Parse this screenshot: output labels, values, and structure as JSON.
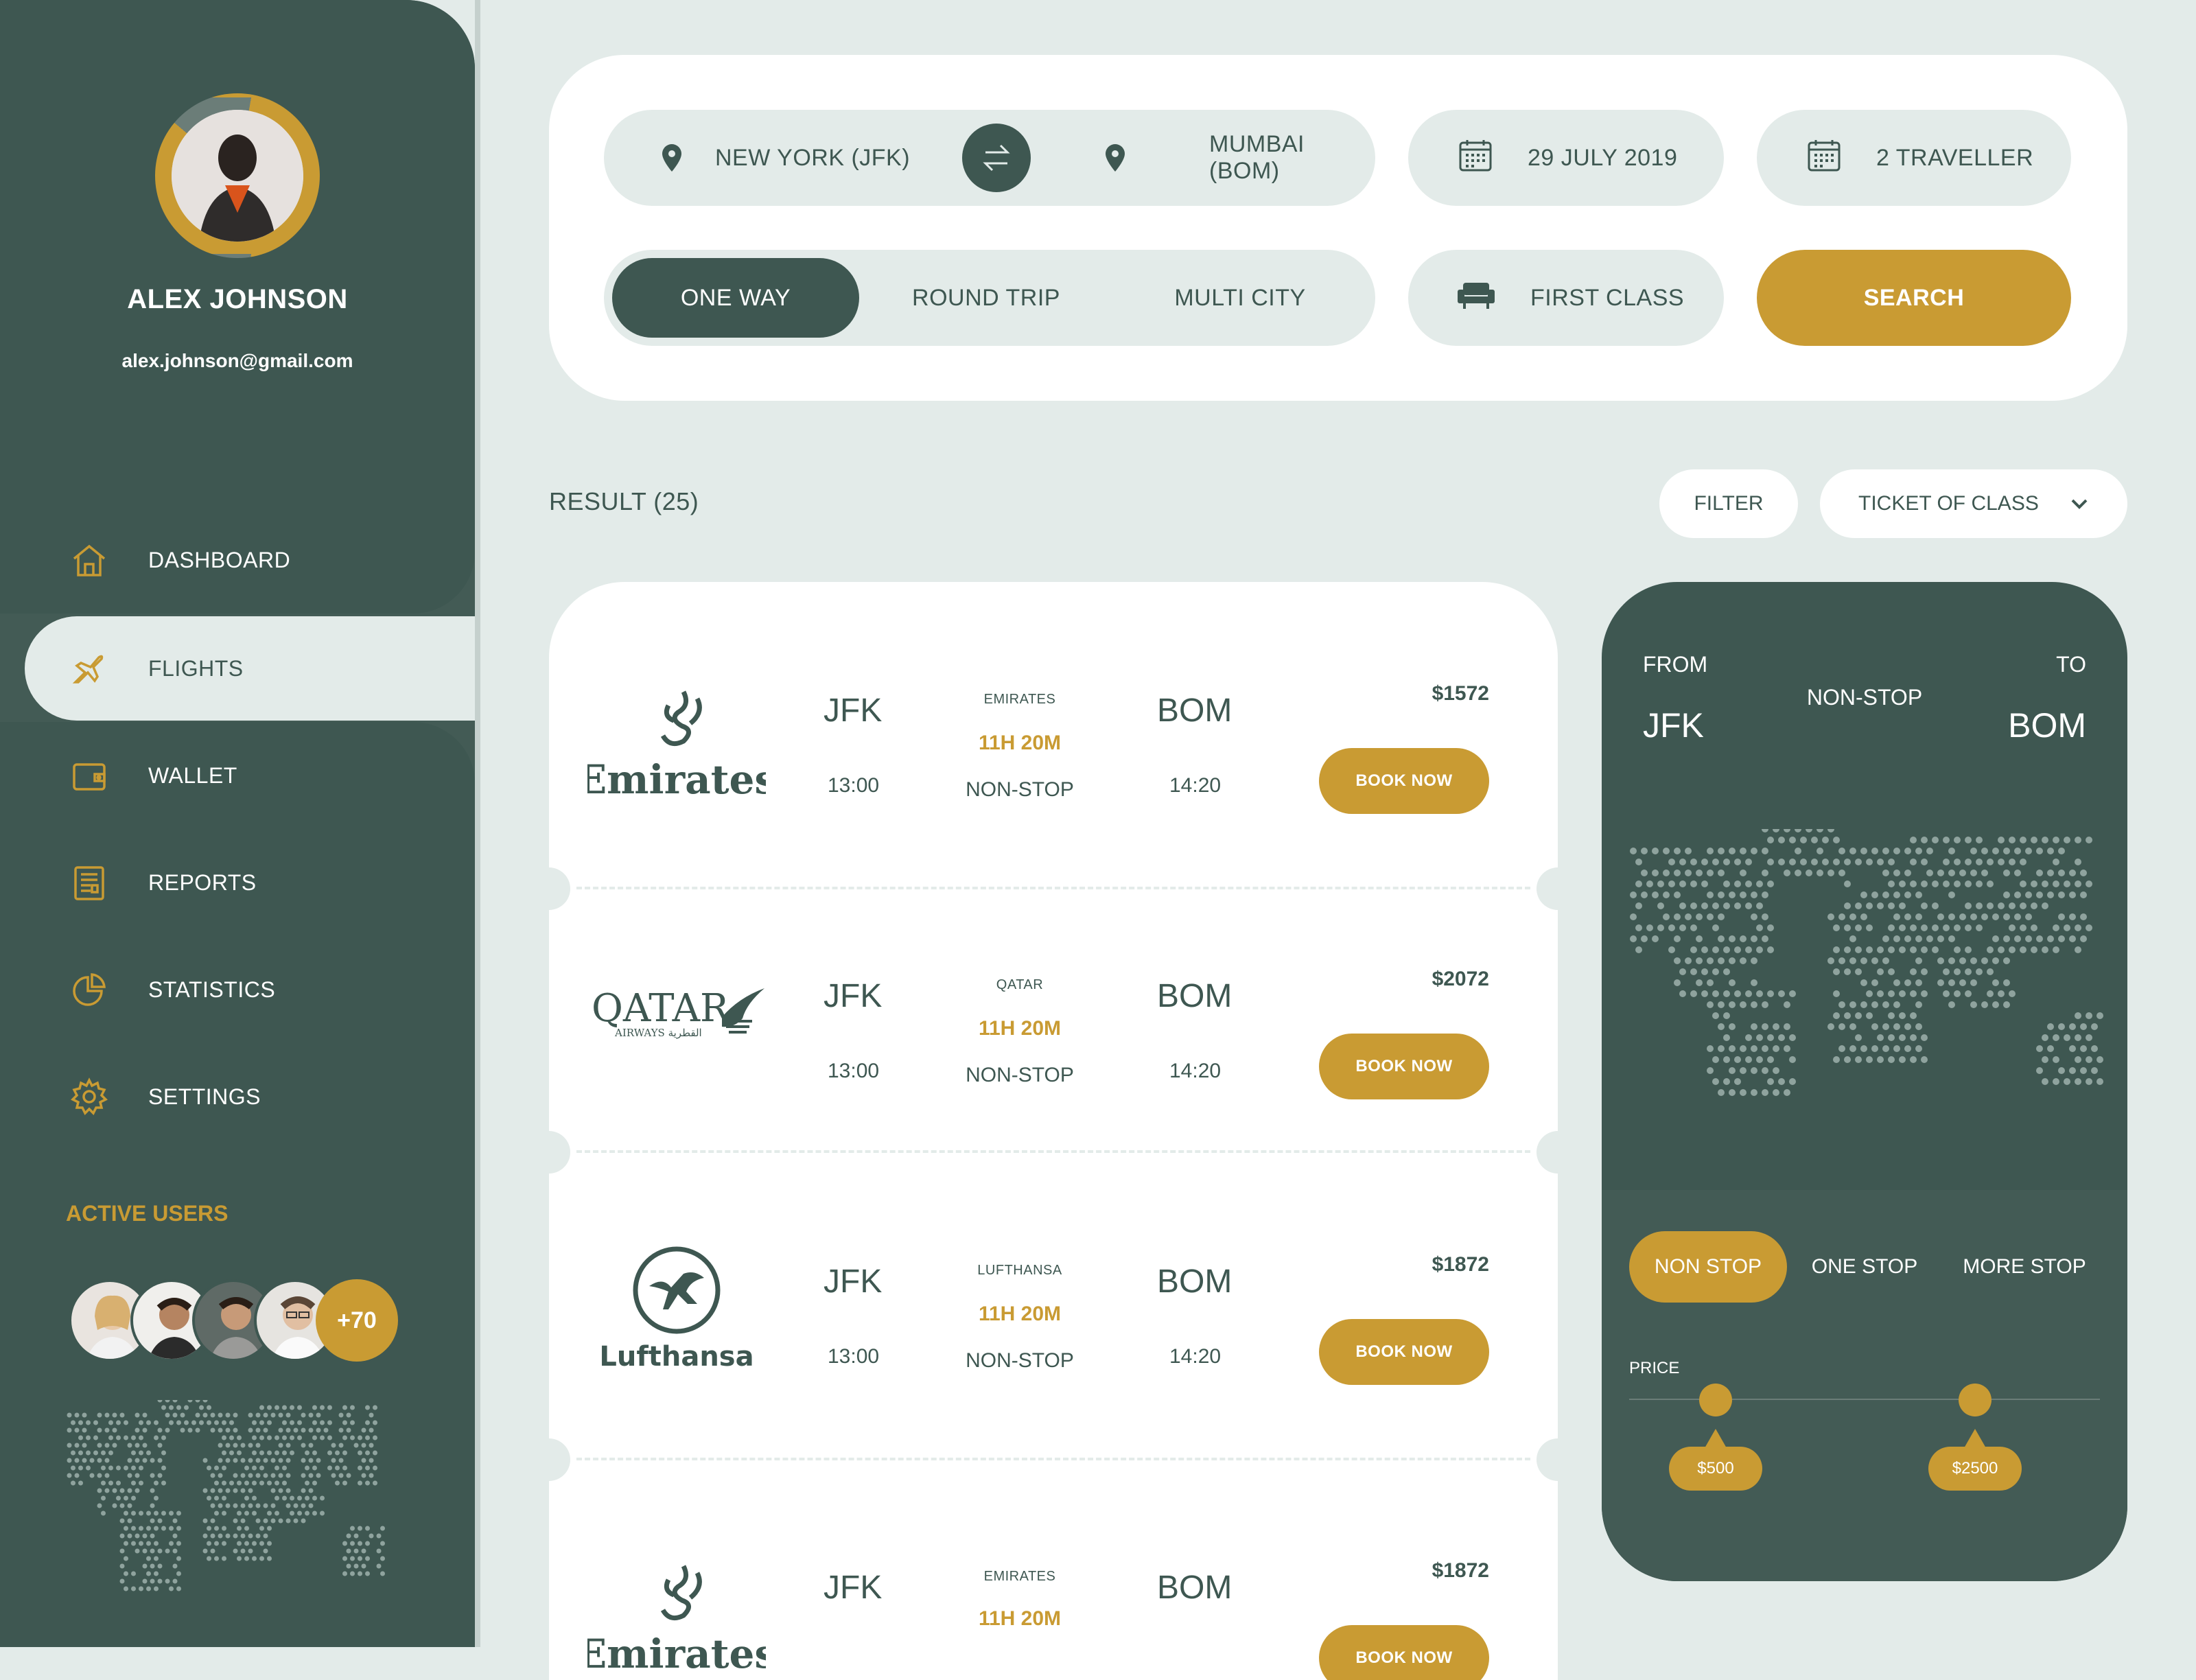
{
  "user": {
    "name": "ALEX JOHNSON",
    "email": "alex.johnson@gmail.com"
  },
  "nav": {
    "items": [
      {
        "label": "DASHBOARD",
        "icon": "home-icon"
      },
      {
        "label": "FLIGHTS",
        "icon": "plane-icon",
        "active": true
      },
      {
        "label": "WALLET",
        "icon": "wallet-icon"
      },
      {
        "label": "REPORTS",
        "icon": "report-icon"
      },
      {
        "label": "STATISTICS",
        "icon": "pie-chart-icon"
      },
      {
        "label": "SETTINGS",
        "icon": "gear-icon"
      }
    ]
  },
  "active_users": {
    "title": "ACTIVE USERS",
    "extra": "+70"
  },
  "search": {
    "from": "NEW YORK (JFK)",
    "to": "MUMBAI (BOM)",
    "date": "29 JULY 2019",
    "travellers": "2 TRAVELLER",
    "trip_types": [
      "ONE WAY",
      "ROUND TRIP",
      "MULTI CITY"
    ],
    "selected_trip_type": "ONE WAY",
    "cabin": "FIRST CLASS",
    "search_label": "SEARCH"
  },
  "results": {
    "label": "RESULT (25)",
    "filter_label": "FILTER",
    "class_dropdown_label": "TICKET OF CLASS",
    "flights": [
      {
        "airline": "EMIRATES",
        "logo_text": "Emirates",
        "from": "JFK",
        "to": "BOM",
        "dep": "13:00",
        "arr": "14:20",
        "duration": "11H 20M",
        "stops": "NON-STOP",
        "price": "$1572",
        "book": "BOOK NOW"
      },
      {
        "airline": "QATAR",
        "logo_text": "QATAR",
        "logo_sub": "AIRWAYS القطرية",
        "from": "JFK",
        "to": "BOM",
        "dep": "13:00",
        "arr": "14:20",
        "duration": "11H 20M",
        "stops": "NON-STOP",
        "price": "$2072",
        "book": "BOOK NOW"
      },
      {
        "airline": "LUFTHANSA",
        "logo_text": "Lufthansa",
        "from": "JFK",
        "to": "BOM",
        "dep": "13:00",
        "arr": "14:20",
        "duration": "11H 20M",
        "stops": "NON-STOP",
        "price": "$1872",
        "book": "BOOK NOW"
      },
      {
        "airline": "EMIRATES",
        "logo_text": "Emirates",
        "from": "JFK",
        "to": "BOM",
        "duration": "11H 20M",
        "price": "$1872",
        "book": "BOOK NOW"
      }
    ]
  },
  "route_card": {
    "from_label": "FROM",
    "to_label": "TO",
    "from_code": "JFK",
    "to_code": "BOM",
    "type": "NON-STOP",
    "stop_options": [
      "NON STOP",
      "ONE STOP",
      "MORE STOP"
    ],
    "selected_stop": "NON STOP",
    "price_label": "PRICE",
    "price_min": "$500",
    "price_max": "$2500"
  },
  "colors": {
    "primary": "#3e5751",
    "accent": "#c99b33",
    "background": "#e3ebe9"
  }
}
